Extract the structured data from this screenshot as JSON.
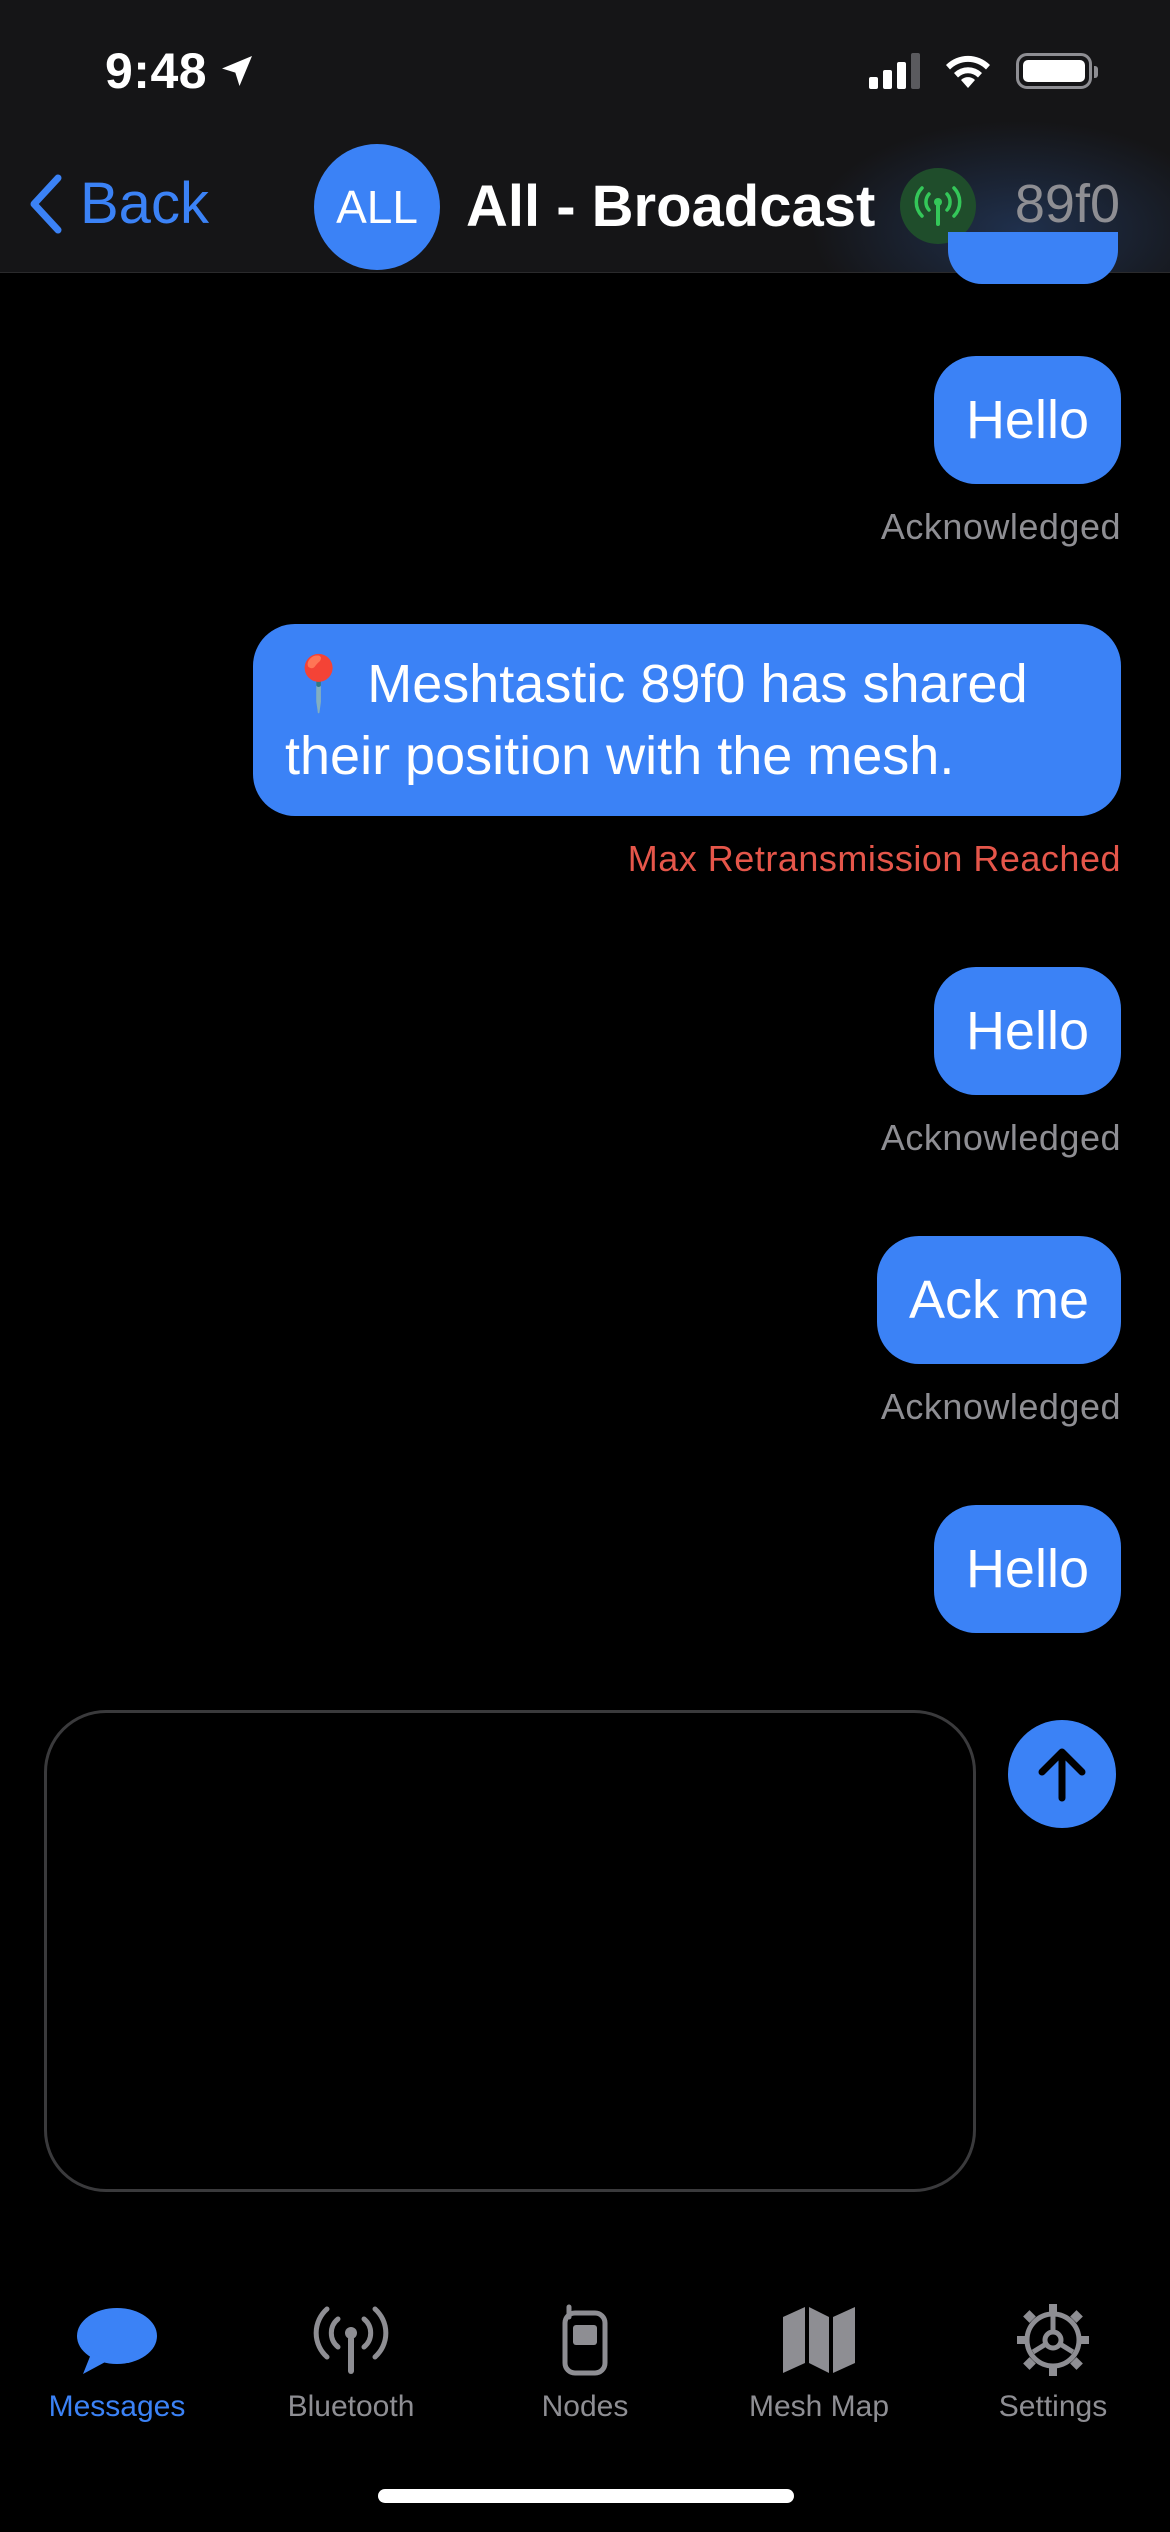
{
  "status_bar": {
    "time": "9:48"
  },
  "nav": {
    "back_label": "Back",
    "channel_avatar": "ALL",
    "title": "All - Broadcast",
    "node_short_name": "89f0"
  },
  "messages": [
    {
      "text": "Hello",
      "status": "Acknowledged"
    },
    {
      "text": "📍 Meshtastic 89f0 has shared their position with the mesh.",
      "status": "Max Retransmission Reached"
    },
    {
      "text": "Hello",
      "status": "Acknowledged"
    },
    {
      "text": "Ack me",
      "status": "Acknowledged"
    },
    {
      "text": "Hello",
      "status": ""
    }
  ],
  "compose": {
    "placeholder": ""
  },
  "tabs": [
    {
      "label": "Messages",
      "icon": "messages-icon",
      "active": true
    },
    {
      "label": "Bluetooth",
      "icon": "bluetooth-antenna-icon",
      "active": false
    },
    {
      "label": "Nodes",
      "icon": "nodes-device-icon",
      "active": false
    },
    {
      "label": "Mesh Map",
      "icon": "map-icon",
      "active": false
    },
    {
      "label": "Settings",
      "icon": "gear-icon",
      "active": false
    }
  ],
  "colors": {
    "accent": "#3b82f6",
    "error": "#e5564a",
    "muted": "#8e8e93",
    "node_badge": "#1f4d2b",
    "node_badge_icon": "#34c759"
  }
}
